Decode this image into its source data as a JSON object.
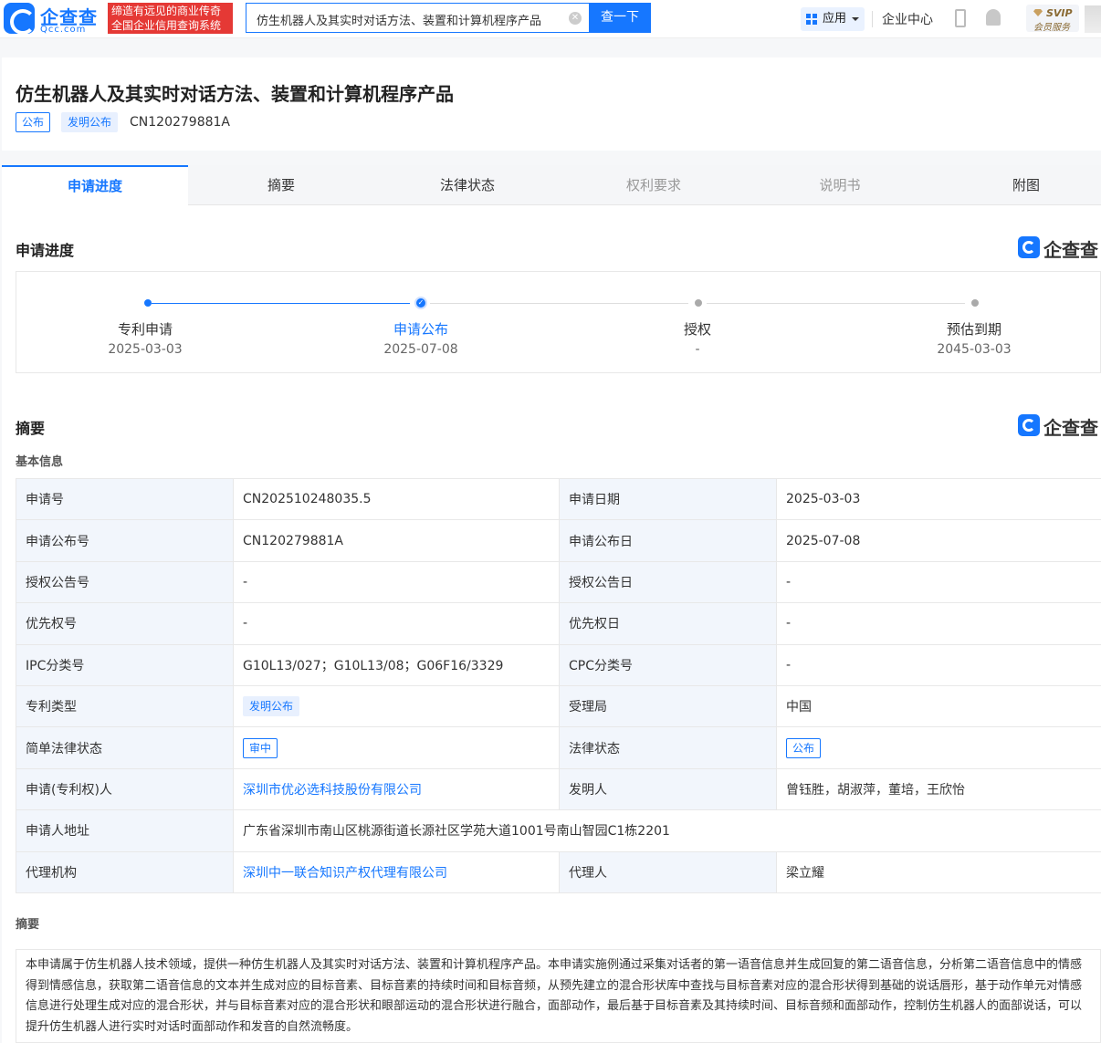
{
  "header": {
    "logo_cn": "企查查",
    "logo_en": "Qcc.com",
    "slogan_line1": "缔造有远见的商业传奇",
    "slogan_line2": "全国企业信用查询系统",
    "search_value": "仿生机器人及其实时对话方法、装置和计算机程序产品",
    "search_button": "查一下",
    "apps_label": "应用",
    "enterprise_center": "企业中心",
    "svip_label": "SVIP",
    "member_label": "会员服务"
  },
  "patent": {
    "title": "仿生机器人及其实时对话方法、装置和计算机程序产品",
    "tag_publish": "公布",
    "tag_type": "发明公布",
    "publication_number": "CN120279881A"
  },
  "tabs": [
    "申请进度",
    "摘要",
    "法律状态",
    "权利要求",
    "说明书",
    "附图"
  ],
  "progress": {
    "title": "申请进度",
    "watermark": "企查查",
    "steps": [
      {
        "label": "专利申请",
        "date": "2025-03-03"
      },
      {
        "label": "申请公布",
        "date": "2025-07-08"
      },
      {
        "label": "授权",
        "date": "-"
      },
      {
        "label": "预估到期",
        "date": "2045-03-03"
      }
    ]
  },
  "summary": {
    "title": "摘要",
    "watermark": "企查查",
    "basic_info_label": "基本信息",
    "rows": [
      {
        "k1": "申请号",
        "v1": "CN202510248035.5",
        "k2": "申请日期",
        "v2": "2025-03-03"
      },
      {
        "k1": "申请公布号",
        "v1": "CN120279881A",
        "k2": "申请公布日",
        "v2": "2025-07-08"
      },
      {
        "k1": "授权公告号",
        "v1": "-",
        "k2": "授权公告日",
        "v2": "-"
      },
      {
        "k1": "优先权号",
        "v1": "-",
        "k2": "优先权日",
        "v2": "-"
      },
      {
        "k1": "IPC分类号",
        "v1": "G10L13/027；G10L13/08；G06F16/3329",
        "k2": "CPC分类号",
        "v2": "-"
      },
      {
        "k1": "专利类型",
        "v1": "发明公布",
        "k2": "受理局",
        "v2": "中国"
      },
      {
        "k1": "简单法律状态",
        "v1": "审中",
        "k2": "法律状态",
        "v2": "公布"
      },
      {
        "k1": "申请(专利权)人",
        "v1": "深圳市优必选科技股份有限公司",
        "k2": "发明人",
        "v2": "曾钰胜，胡淑萍，董培，王欣怡"
      },
      {
        "k1": "申请人地址",
        "v1": "广东省深圳市南山区桃源街道长源社区学苑大道1001号南山智园C1栋2201"
      },
      {
        "k1": "代理机构",
        "v1": "深圳中一联合知识产权代理有限公司",
        "k2": "代理人",
        "v2": "梁立耀"
      }
    ],
    "abstract_label": "摘要",
    "abstract_text": "本申请属于仿生机器人技术领域，提供一种仿生机器人及其实时对话方法、装置和计算机程序产品。本申请实施例通过采集对话者的第一语音信息并生成回复的第二语音信息，分析第二语音信息中的情感得到情感信息，获取第二语音信息的文本并生成对应的目标音素、目标音素的持续时间和目标音频，从预先建立的混合形状库中查找与目标音素对应的混合形状得到基础的说话唇形，基于动作单元对情感信息进行处理生成对应的混合形状，并与目标音素对应的混合形状和眼部运动的混合形状进行融合，面部动作，最后基于目标音素及其持续时间、目标音频和面部动作，控制仿生机器人的面部说话，可以提升仿生机器人进行实时对话时面部动作和发音的自然流畅度。"
  },
  "colors": {
    "accent": "#1677ff",
    "slogan_bg": "#e53935",
    "key_cell_bg": "#f2f6fc"
  }
}
